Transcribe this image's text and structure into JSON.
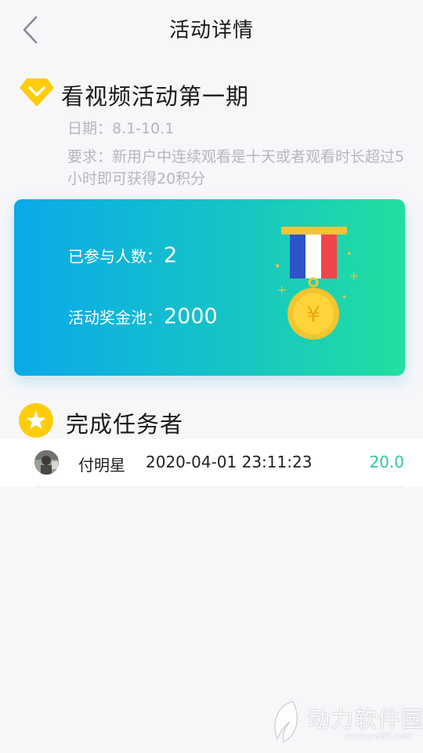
{
  "header": {
    "title": "活动详情",
    "back_icon": "chevron-left-icon"
  },
  "activity": {
    "icon": "diamond-chevron-icon",
    "title": "看视频活动第一期",
    "date_text": "日期：8.1-10.1",
    "requirement_text": "要求：新用户中连续观看是十天或者观看时长超过5小时即可获得20积分"
  },
  "stats": {
    "participants_label": "已参与人数：",
    "participants_value": "2",
    "prize_pool_label": "活动奖金池：",
    "prize_pool_value": "2000",
    "medal_icon": "medal-yuan-icon",
    "medal_symbol": "¥",
    "colors": {
      "gradient_start": "#0aa9ea",
      "gradient_end": "#22df9f"
    }
  },
  "finishers": {
    "icon": "star-icon",
    "title": "完成任务者",
    "rows": [
      {
        "name": "付明星",
        "time": "2020-04-01 23:11:23",
        "score": "20.0"
      }
    ]
  },
  "watermark": {
    "text": "动力软件园",
    "url": "www.pw88.com"
  }
}
